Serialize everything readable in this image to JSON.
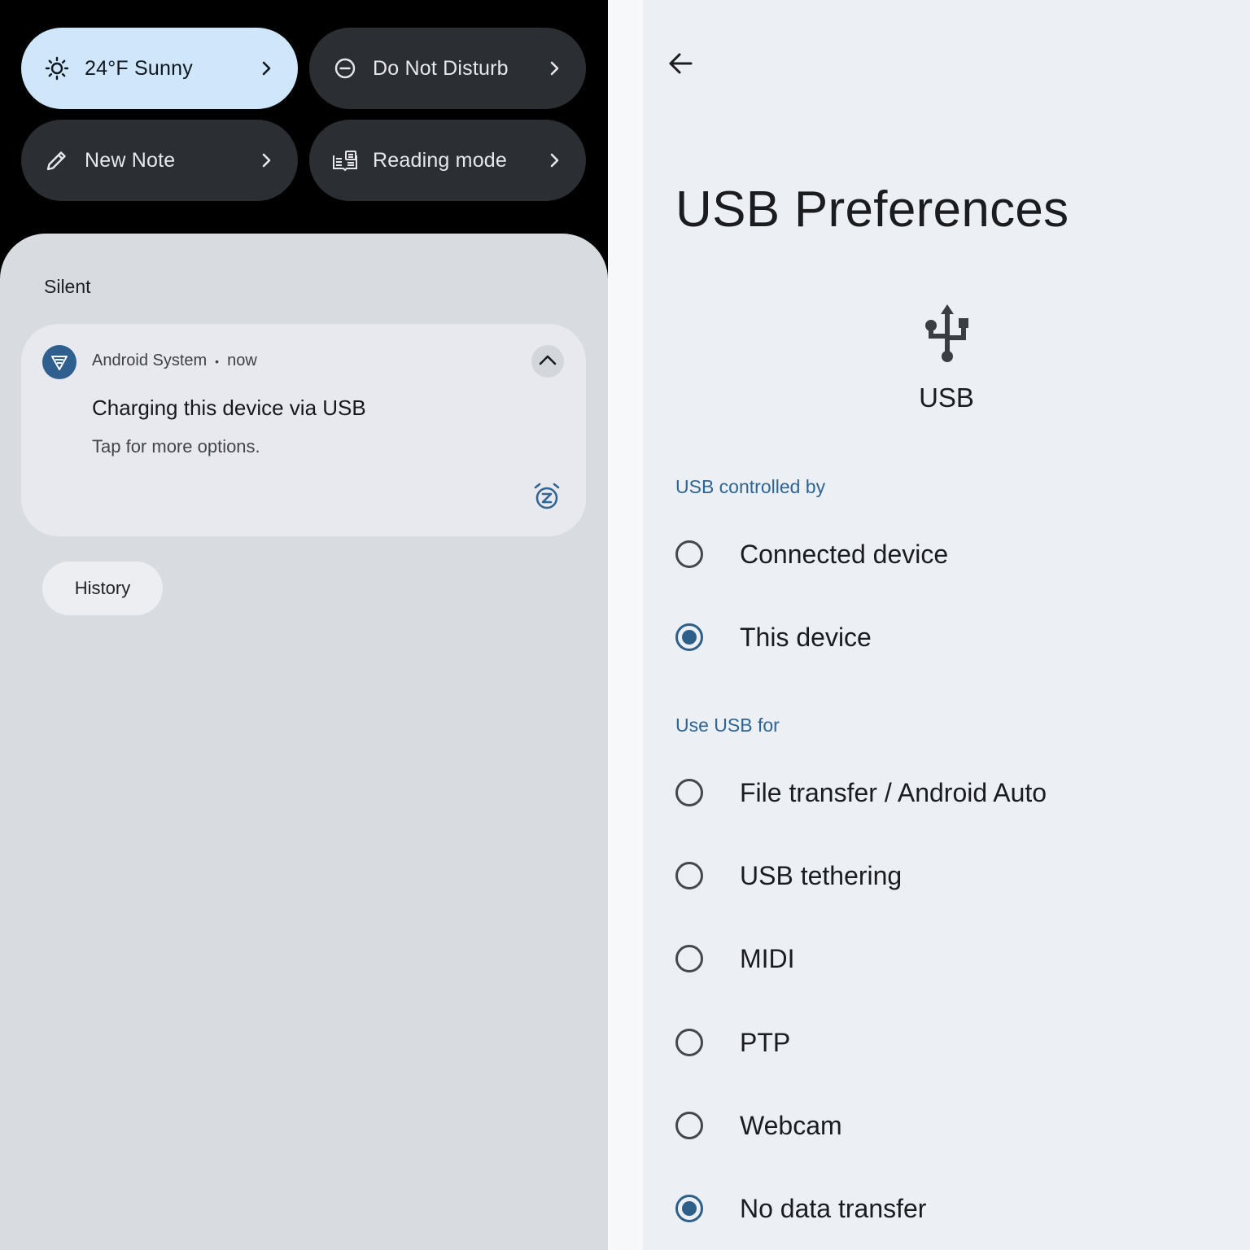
{
  "quick_tiles": {
    "weather": {
      "label": "24°F Sunny",
      "icon": "sun-icon",
      "active": true
    },
    "dnd": {
      "label": "Do Not Disturb",
      "icon": "do-not-disturb-icon"
    },
    "note": {
      "label": "New Note",
      "icon": "pencil-icon"
    },
    "reading": {
      "label": "Reading mode",
      "icon": "reading-mode-icon"
    }
  },
  "notifications": {
    "section_label": "Silent",
    "card": {
      "app_name": "Android System",
      "separator": "•",
      "time": "now",
      "title": "Charging this device via USB",
      "text": "Tap for more options."
    },
    "history_label": "History"
  },
  "settings": {
    "title": "USB Preferences",
    "hero_label": "USB",
    "controlled_by": {
      "header": "USB controlled by",
      "options": [
        {
          "label": "Connected device",
          "checked": false
        },
        {
          "label": "This device",
          "checked": true
        }
      ]
    },
    "use_for": {
      "header": "Use USB for",
      "options": [
        {
          "label": "File transfer / Android Auto",
          "checked": false
        },
        {
          "label": "USB tethering",
          "checked": false
        },
        {
          "label": "MIDI",
          "checked": false
        },
        {
          "label": "PTP",
          "checked": false
        },
        {
          "label": "Webcam",
          "checked": false
        },
        {
          "label": "No data transfer",
          "checked": true
        }
      ]
    }
  },
  "colors": {
    "accent": "#2e5f88",
    "section_header": "#2e6593",
    "active_tile": "#cfe6fb",
    "tile": "#2b2e33"
  }
}
